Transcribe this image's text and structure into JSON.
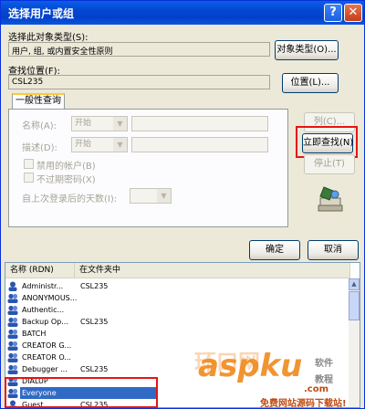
{
  "window": {
    "title": "选择用户或组",
    "help_glyph": "?",
    "close_glyph": "✕"
  },
  "object_type": {
    "label": "选择此对象类型(S):",
    "value": "用户, 组, 或内置安全性原则",
    "button": "对象类型(O)..."
  },
  "location": {
    "label": "查找位置(F):",
    "value": "CSL235",
    "button": "位置(L)..."
  },
  "tab": {
    "label": "一般性查询"
  },
  "query": {
    "name_label": "名称(A):",
    "name_mode": "开始",
    "desc_label": "描述(D):",
    "desc_mode": "开始",
    "disabled_accounts": "禁用的帐户(B)",
    "no_expire_password": "不过期密码(X)",
    "days_label": "自上次登录后的天数(I):"
  },
  "side_buttons": {
    "columns": "列(C)...",
    "find_now": "立即查找(N)",
    "stop": "停止(T)"
  },
  "dialog_buttons": {
    "ok": "确定",
    "cancel": "取消"
  },
  "results": {
    "columns": [
      "名称 (RDN)",
      "在文件夹中"
    ],
    "rows": [
      {
        "name": "Administr...",
        "folder": "CSL235"
      },
      {
        "name": "ANONYMOUS...",
        "folder": ""
      },
      {
        "name": "Authentic...",
        "folder": ""
      },
      {
        "name": "Backup Op...",
        "folder": "CSL235"
      },
      {
        "name": "BATCH",
        "folder": ""
      },
      {
        "name": "CREATOR G...",
        "folder": ""
      },
      {
        "name": "CREATOR O...",
        "folder": ""
      },
      {
        "name": "Debugger ...",
        "folder": "CSL235"
      },
      {
        "name": "DIALUP",
        "folder": ""
      },
      {
        "name": "Everyone",
        "folder": ""
      },
      {
        "name": "Guest",
        "folder": "CSL235"
      }
    ],
    "scroll_up_glyph": "▲"
  },
  "watermark": {
    "brand_cn": "环口网",
    "brand": "aspku",
    "com": ".com",
    "side_top": "软件",
    "side_bottom": "教程",
    "footer": "免费网站源码下载站!"
  }
}
